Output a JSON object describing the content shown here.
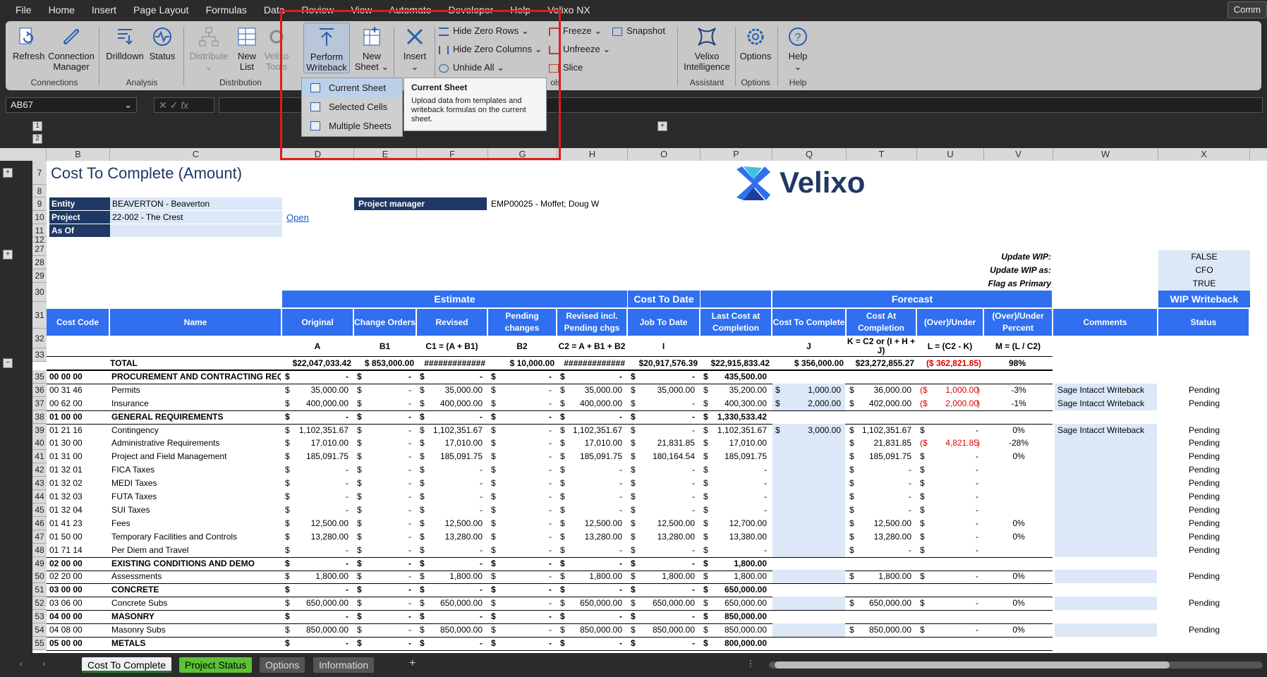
{
  "menu": [
    "File",
    "Home",
    "Insert",
    "Page Layout",
    "Formulas",
    "Data",
    "Review",
    "View",
    "Automate",
    "Developer",
    "Help",
    "Velixo NX"
  ],
  "comments_btn": "Comm",
  "ribbon": {
    "refresh": "Refresh",
    "connection_manager": [
      "Connection",
      "Manager"
    ],
    "drilldown": "Drilldown",
    "status": "Status",
    "distribute": "Distribute",
    "new_list": [
      "New",
      "List"
    ],
    "velixo_tools": [
      "Velixo",
      "Tools"
    ],
    "perform_writeback": [
      "Perform",
      "Writeback"
    ],
    "new_sheet": [
      "New",
      "Sheet"
    ],
    "insert": "Insert",
    "hide_zero_rows": "Hide Zero Rows",
    "hide_zero_columns": "Hide Zero Columns",
    "unhide_all": "Unhide All",
    "freeze": "Freeze",
    "unfreeze": "Unfreeze",
    "slice": "Slice",
    "snapshot": "Snapshot",
    "velixo_intelligence": [
      "Velixo",
      "Intelligence"
    ],
    "options": "Options",
    "help": "Help",
    "groups": {
      "connections": "Connections",
      "analysis": "Analysis",
      "distribution": "Distribution",
      "tools": "ols",
      "assistant": "Assistant",
      "options": "Options",
      "help": "Help"
    }
  },
  "dropdown": [
    "Current Sheet",
    "Selected Cells",
    "Multiple Sheets"
  ],
  "tooltip": {
    "title": "Current Sheet",
    "desc": "Upload data from templates and writeback formulas on the current sheet."
  },
  "namebox": "AB67",
  "columns": [
    "B",
    "C",
    "D",
    "E",
    "F",
    "G",
    "H",
    "O",
    "P",
    "Q",
    "T",
    "U",
    "V",
    "W",
    "X"
  ],
  "sheet": {
    "title": "Cost To Complete (Amount)",
    "logo_text": "Velixo",
    "entity_label": "Entity",
    "entity_value": "BEAVERTON - Beaverton",
    "project_label": "Project",
    "project_value": "22-002 - The Crest",
    "asof_label": "As Of",
    "open_link": "Open",
    "pm_label": "Project manager",
    "pm_value": "EMP00025 - Moffet; Doug W",
    "update_wip_label": "Update WIP:",
    "update_wip_value": "FALSE",
    "update_wip_as_label": "Update WIP as:",
    "update_wip_as_value": "CFO",
    "flag_primary_label": "Flag as Primary",
    "flag_primary_value": "TRUE",
    "grp_estimate": "Estimate",
    "grp_cost_to_date": "Cost To Date",
    "grp_forecast": "Forecast",
    "grp_wip": "WIP Writeback",
    "hdr": [
      "Cost Code",
      "Name",
      "Original",
      "Change Orders",
      "Revised",
      "Pending changes",
      "Revised incl. Pending chgs",
      "Job To Date",
      "Last Cost at Completion",
      "Cost To Complete",
      "Cost At Completion",
      "(Over)/Under",
      "(Over)/Under Percent",
      "Comments",
      "Status"
    ],
    "formula": [
      "",
      "",
      "A",
      "B1",
      "C1 = (A + B1)",
      "B2",
      "C2 = A + B1 + B2",
      "I",
      "",
      "J",
      "K = C2 or (I + H + J)",
      "L = (C2 - K)",
      "M = (L / C2)",
      "",
      ""
    ],
    "total": {
      "label": "TOTAL",
      "orig": "$22,047,033.42",
      "co": "$  853,000.00",
      "rev": "#############",
      "pend": "$       10,000.00",
      "revp": "#############",
      "jtd": "$20,917,576.39",
      "lcc": "$22,915,833.42",
      "ctc": "$       356,000.00",
      "cac": "$23,272,855.27",
      "ou": "($   362,821.85)",
      "pct": "98%"
    }
  },
  "rows": [
    {
      "n": "35",
      "code": "00 00 00",
      "name": "PROCUREMENT AND CONTRACTING REQ",
      "bold": true,
      "orig": "-",
      "co": "-",
      "rev": "-",
      "pend": "-",
      "revp": "-",
      "jtd": "-",
      "lcc": "435,500.00"
    },
    {
      "n": "36",
      "code": "00 31 46",
      "name": "Permits",
      "orig": "35,000.00",
      "co": "-",
      "rev": "35,000.00",
      "pend": "-",
      "revp": "35,000.00",
      "jtd": "35,000.00",
      "lcc": "35,200.00",
      "ctc": "1,000.00",
      "cac": "36,000.00",
      "ou": "1,000.00",
      "neg": true,
      "pct": "-3%",
      "cmt": "Sage Intacct Writeback",
      "st": "Pending"
    },
    {
      "n": "37",
      "code": "00 62 00",
      "name": "Insurance",
      "orig": "400,000.00",
      "co": "-",
      "rev": "400,000.00",
      "pend": "-",
      "revp": "400,000.00",
      "jtd": "-",
      "lcc": "400,300.00",
      "ctc": "2,000.00",
      "cac": "402,000.00",
      "ou": "2,000.00",
      "neg": true,
      "pct": "-1%",
      "cmt": "Sage Intacct Writeback",
      "st": "Pending"
    },
    {
      "n": "38",
      "code": "01 00 00",
      "name": "GENERAL REQUIREMENTS",
      "bold": true,
      "orig": "-",
      "co": "-",
      "rev": "-",
      "pend": "-",
      "revp": "-",
      "jtd": "-",
      "lcc": "1,330,533.42"
    },
    {
      "n": "39",
      "code": "01 21 16",
      "name": "Contingency",
      "orig": "1,102,351.67",
      "co": "-",
      "rev": "1,102,351.67",
      "pend": "-",
      "revp": "1,102,351.67",
      "jtd": "-",
      "lcc": "1,102,351.67",
      "ctc": "3,000.00",
      "cac": "1,102,351.67",
      "ou": "-",
      "pct": "0%",
      "cmt": "Sage Intacct Writeback",
      "st": "Pending"
    },
    {
      "n": "40",
      "code": "01 30 00",
      "name": "Administrative Requirements",
      "orig": "17,010.00",
      "co": "-",
      "rev": "17,010.00",
      "pend": "-",
      "revp": "17,010.00",
      "jtd": "21,831.85",
      "lcc": "17,010.00",
      "ctc": "",
      "cac": "21,831.85",
      "ou": "4,821.85",
      "neg": true,
      "pct": "-28%",
      "cmt": "",
      "st": "Pending"
    },
    {
      "n": "41",
      "code": "01 31 00",
      "name": "Project and Field Management",
      "orig": "185,091.75",
      "co": "-",
      "rev": "185,091.75",
      "pend": "-",
      "revp": "185,091.75",
      "jtd": "180,164.54",
      "lcc": "185,091.75",
      "ctc": "",
      "cac": "185,091.75",
      "ou": "-",
      "pct": "0%",
      "cmt": "",
      "st": "Pending"
    },
    {
      "n": "42",
      "code": "01 32 01",
      "name": "FICA Taxes",
      "orig": "-",
      "co": "-",
      "rev": "-",
      "pend": "-",
      "revp": "-",
      "jtd": "-",
      "lcc": "-",
      "ctc": "",
      "cac": "-",
      "ou": "-",
      "pct": "",
      "cmt": "",
      "st": "Pending"
    },
    {
      "n": "43",
      "code": "01 32 02",
      "name": "MEDI Taxes",
      "orig": "-",
      "co": "-",
      "rev": "-",
      "pend": "-",
      "revp": "-",
      "jtd": "-",
      "lcc": "-",
      "ctc": "",
      "cac": "-",
      "ou": "-",
      "pct": "",
      "cmt": "",
      "st": "Pending"
    },
    {
      "n": "44",
      "code": "01 32 03",
      "name": "FUTA Taxes",
      "orig": "-",
      "co": "-",
      "rev": "-",
      "pend": "-",
      "revp": "-",
      "jtd": "-",
      "lcc": "-",
      "ctc": "",
      "cac": "-",
      "ou": "-",
      "pct": "",
      "cmt": "",
      "st": "Pending"
    },
    {
      "n": "45",
      "code": "01 32 04",
      "name": "SUI Taxes",
      "orig": "-",
      "co": "-",
      "rev": "-",
      "pend": "-",
      "revp": "-",
      "jtd": "-",
      "lcc": "-",
      "ctc": "",
      "cac": "-",
      "ou": "-",
      "pct": "",
      "cmt": "",
      "st": "Pending"
    },
    {
      "n": "46",
      "code": "01 41 23",
      "name": "Fees",
      "orig": "12,500.00",
      "co": "-",
      "rev": "12,500.00",
      "pend": "-",
      "revp": "12,500.00",
      "jtd": "12,500.00",
      "lcc": "12,700.00",
      "ctc": "",
      "cac": "12,500.00",
      "ou": "-",
      "pct": "0%",
      "cmt": "",
      "st": "Pending"
    },
    {
      "n": "47",
      "code": "01 50 00",
      "name": "Temporary Facilities and Controls",
      "orig": "13,280.00",
      "co": "-",
      "rev": "13,280.00",
      "pend": "-",
      "revp": "13,280.00",
      "jtd": "13,280.00",
      "lcc": "13,380.00",
      "ctc": "",
      "cac": "13,280.00",
      "ou": "-",
      "pct": "0%",
      "cmt": "",
      "st": "Pending"
    },
    {
      "n": "48",
      "code": "01 71 14",
      "name": "Per Diem and Travel",
      "orig": "-",
      "co": "-",
      "rev": "-",
      "pend": "-",
      "revp": "-",
      "jtd": "-",
      "lcc": "-",
      "ctc": "",
      "cac": "-",
      "ou": "-",
      "pct": "",
      "cmt": "",
      "st": "Pending"
    },
    {
      "n": "49",
      "code": "02 00 00",
      "name": "EXISTING CONDITIONS AND DEMO",
      "bold": true,
      "orig": "-",
      "co": "-",
      "rev": "-",
      "pend": "-",
      "revp": "-",
      "jtd": "-",
      "lcc": "1,800.00"
    },
    {
      "n": "50",
      "code": "02 20 00",
      "name": "Assessments",
      "orig": "1,800.00",
      "co": "-",
      "rev": "1,800.00",
      "pend": "-",
      "revp": "1,800.00",
      "jtd": "1,800.00",
      "lcc": "1,800.00",
      "ctc": "",
      "cac": "1,800.00",
      "ou": "-",
      "pct": "0%",
      "cmt": "",
      "st": "Pending"
    },
    {
      "n": "51",
      "code": "03 00 00",
      "name": "CONCRETE",
      "bold": true,
      "orig": "-",
      "co": "-",
      "rev": "-",
      "pend": "-",
      "revp": "-",
      "jtd": "-",
      "lcc": "650,000.00"
    },
    {
      "n": "52",
      "code": "03 06 00",
      "name": "Concrete Subs",
      "orig": "650,000.00",
      "co": "-",
      "rev": "650,000.00",
      "pend": "-",
      "revp": "650,000.00",
      "jtd": "650,000.00",
      "lcc": "650,000.00",
      "ctc": "",
      "cac": "650,000.00",
      "ou": "-",
      "pct": "0%",
      "cmt": "",
      "st": "Pending"
    },
    {
      "n": "53",
      "code": "04 00 00",
      "name": "MASONRY",
      "bold": true,
      "orig": "-",
      "co": "-",
      "rev": "-",
      "pend": "-",
      "revp": "-",
      "jtd": "-",
      "lcc": "850,000.00"
    },
    {
      "n": "54",
      "code": "04 08 00",
      "name": "Masonry Subs",
      "orig": "850,000.00",
      "co": "-",
      "rev": "850,000.00",
      "pend": "-",
      "revp": "850,000.00",
      "jtd": "850,000.00",
      "lcc": "850,000.00",
      "ctc": "",
      "cac": "850,000.00",
      "ou": "-",
      "pct": "0%",
      "cmt": "",
      "st": "Pending"
    },
    {
      "n": "55",
      "code": "05 00 00",
      "name": "METALS",
      "bold": true,
      "orig": "-",
      "co": "-",
      "rev": "-",
      "pend": "-",
      "revp": "-",
      "jtd": "-",
      "lcc": "800,000.00"
    }
  ],
  "tabs": [
    "Cost To Complete",
    "Project Status",
    "Options",
    "Information"
  ],
  "colors": {
    "accent": "#2f6ff0",
    "navy": "#1f3864",
    "light_blue": "#dce8f8",
    "tab_green": "#5bc236",
    "highlight_red": "#e01b1b"
  }
}
